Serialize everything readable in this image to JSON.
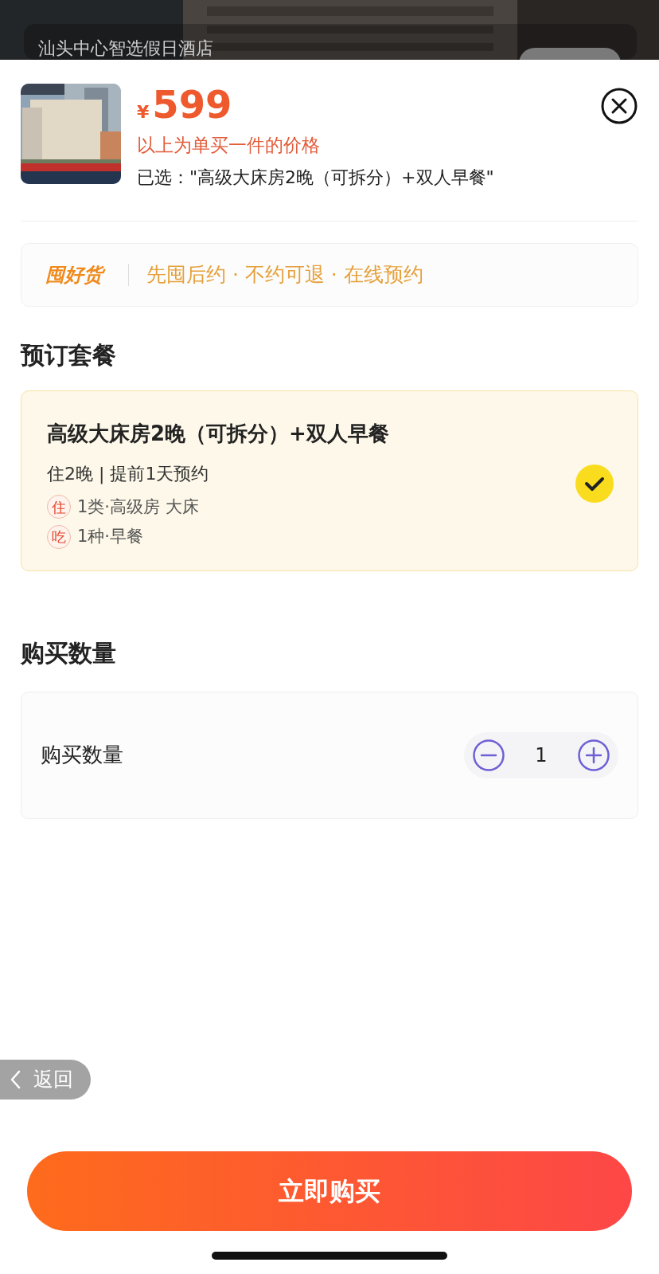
{
  "background_page": {
    "title": "汕头中心智选假日酒店"
  },
  "product": {
    "currency": "¥",
    "price": "599",
    "price_note": "以上为单买一件的价格",
    "selection": "已选：\"高级大床房2晚（可拆分）+双人早餐\""
  },
  "banner": {
    "brand": "囤好货",
    "text": "先囤后约 · 不约可退 · 在线预约"
  },
  "packages_section": {
    "heading": "预订套餐",
    "packages": [
      {
        "name": "高级大床房2晚（可拆分）+双人早餐",
        "terms": "住2晚 | 提前1天预约",
        "selected": true,
        "details": [
          {
            "tag": "住",
            "text": "1类·高级房 大床"
          },
          {
            "tag": "吃",
            "text": "1种·早餐"
          }
        ]
      }
    ]
  },
  "quantity_section": {
    "heading": "购买数量",
    "label": "购买数量",
    "value": "1"
  },
  "back_button": {
    "label": "返回"
  },
  "buy_button": {
    "label": "立即购买"
  }
}
